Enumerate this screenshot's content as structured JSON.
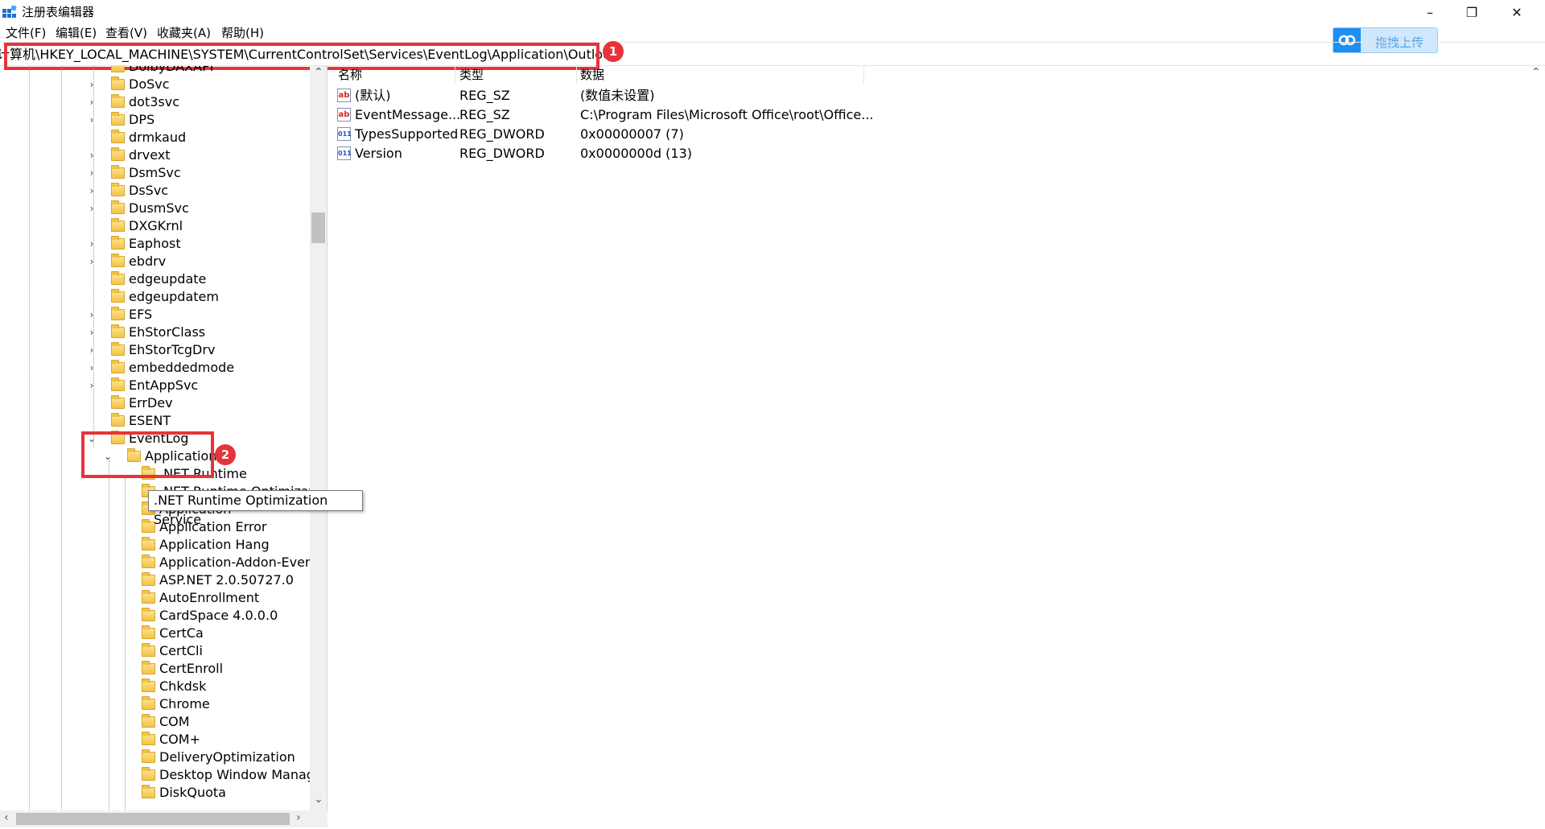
{
  "window": {
    "title": "注册表编辑器",
    "minimize": "–",
    "restore": "❐",
    "close": "✕"
  },
  "menu": [
    "文件(F)",
    "编辑(E)",
    "查看(V)",
    "收藏夹(A)",
    "帮助(H)"
  ],
  "address": {
    "path": "计算机\\HKEY_LOCAL_MACHINE\\SYSTEM\\CurrentControlSet\\Services\\EventLog\\Application\\Outlook"
  },
  "annotations": {
    "badge1": "1",
    "badge2": "2"
  },
  "upload_button": {
    "label": "拖拽上传"
  },
  "tree": [
    {
      "label": "DolbyDAXAPI",
      "expand": "",
      "level": 1
    },
    {
      "label": "DoSvc",
      "expand": "›",
      "level": 1
    },
    {
      "label": "dot3svc",
      "expand": "›",
      "level": 1
    },
    {
      "label": "DPS",
      "expand": "›",
      "level": 1
    },
    {
      "label": "drmkaud",
      "expand": "",
      "level": 1
    },
    {
      "label": "drvext",
      "expand": "›",
      "level": 1
    },
    {
      "label": "DsmSvc",
      "expand": "›",
      "level": 1
    },
    {
      "label": "DsSvc",
      "expand": "›",
      "level": 1
    },
    {
      "label": "DusmSvc",
      "expand": "›",
      "level": 1
    },
    {
      "label": "DXGKrnl",
      "expand": "",
      "level": 1
    },
    {
      "label": "Eaphost",
      "expand": "›",
      "level": 1
    },
    {
      "label": "ebdrv",
      "expand": "›",
      "level": 1
    },
    {
      "label": "edgeupdate",
      "expand": "",
      "level": 1
    },
    {
      "label": "edgeupdatem",
      "expand": "",
      "level": 1
    },
    {
      "label": "EFS",
      "expand": "›",
      "level": 1
    },
    {
      "label": "EhStorClass",
      "expand": "›",
      "level": 1
    },
    {
      "label": "EhStorTcgDrv",
      "expand": "›",
      "level": 1
    },
    {
      "label": "embeddedmode",
      "expand": "›",
      "level": 1
    },
    {
      "label": "EntAppSvc",
      "expand": "›",
      "level": 1
    },
    {
      "label": "ErrDev",
      "expand": "",
      "level": 1
    },
    {
      "label": "ESENT",
      "expand": "",
      "level": 1
    },
    {
      "label": "EventLog",
      "expand": "⌄",
      "level": 1
    },
    {
      "label": "Application",
      "expand": "⌄",
      "level": 2
    },
    {
      "label": ".NET Runtime",
      "expand": "",
      "level": 3
    },
    {
      "label": ".NET Runtime Optimization Service",
      "expand": "",
      "level": 3
    },
    {
      "label": "Application",
      "expand": "",
      "level": 3
    },
    {
      "label": "Application Error",
      "expand": "",
      "level": 3
    },
    {
      "label": "Application Hang",
      "expand": "",
      "level": 3
    },
    {
      "label": "Application-Addon-Event-I",
      "expand": "",
      "level": 3
    },
    {
      "label": "ASP.NET 2.0.50727.0",
      "expand": "",
      "level": 3
    },
    {
      "label": "AutoEnrollment",
      "expand": "",
      "level": 3
    },
    {
      "label": "CardSpace 4.0.0.0",
      "expand": "",
      "level": 3
    },
    {
      "label": "CertCa",
      "expand": "",
      "level": 3
    },
    {
      "label": "CertCli",
      "expand": "",
      "level": 3
    },
    {
      "label": "CertEnroll",
      "expand": "",
      "level": 3
    },
    {
      "label": "Chkdsk",
      "expand": "",
      "level": 3
    },
    {
      "label": "Chrome",
      "expand": "",
      "level": 3
    },
    {
      "label": "COM",
      "expand": "",
      "level": 3
    },
    {
      "label": "COM+",
      "expand": "",
      "level": 3
    },
    {
      "label": "DeliveryOptimization",
      "expand": "",
      "level": 3
    },
    {
      "label": "Desktop Window Manager",
      "expand": "",
      "level": 3
    },
    {
      "label": "DiskQuota",
      "expand": "",
      "level": 3
    }
  ],
  "tooltip": ".NET Runtime Optimization Service",
  "values_header": {
    "name": "名称",
    "type": "类型",
    "data": "数据"
  },
  "values": [
    {
      "icon": "ab",
      "kind": "sz",
      "name": "(默认)",
      "type": "REG_SZ",
      "data": "(数值未设置)"
    },
    {
      "icon": "ab",
      "kind": "sz",
      "name": "EventMessage...",
      "type": "REG_SZ",
      "data": "C:\\Program Files\\Microsoft Office\\root\\Office..."
    },
    {
      "icon": "011",
      "kind": "dw",
      "name": "TypesSupported",
      "type": "REG_DWORD",
      "data": "0x00000007 (7)"
    },
    {
      "icon": "011",
      "kind": "dw",
      "name": "Version",
      "type": "REG_DWORD",
      "data": "0x0000000d (13)"
    }
  ],
  "scroll_arrows": {
    "up": "⌃",
    "down": "⌄",
    "left": "‹",
    "right": "›"
  }
}
